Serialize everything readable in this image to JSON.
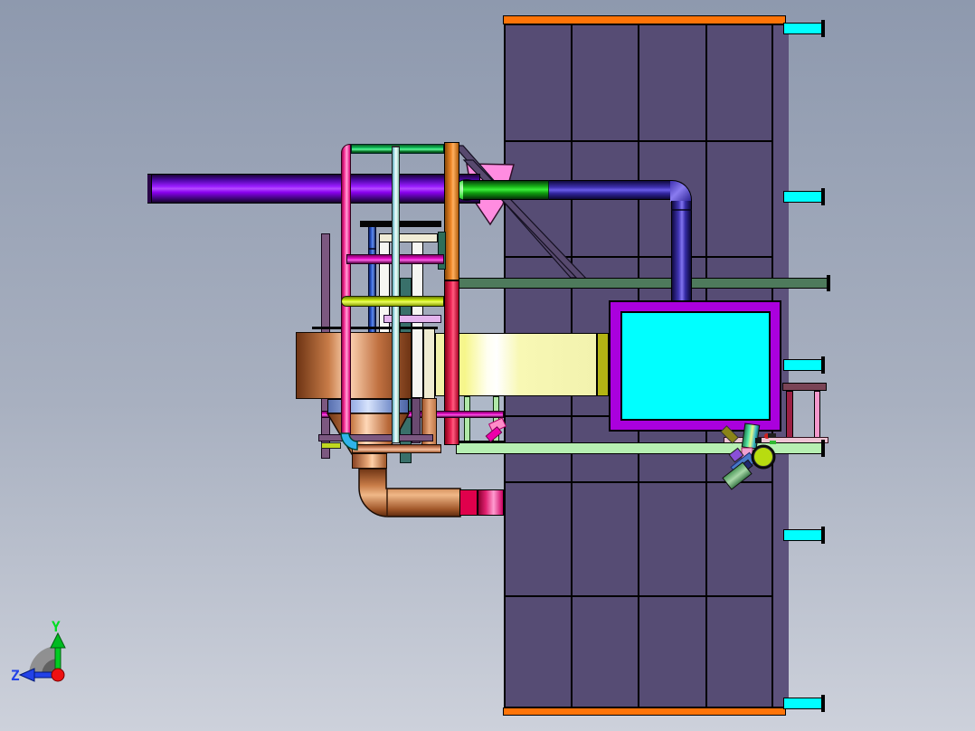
{
  "viewport": {
    "kind": "cad-3d-view"
  },
  "triad": {
    "y_label": "Y",
    "z_label": "Z",
    "y_color": "#00cc22",
    "z_color": "#2342e8",
    "origin_color": "#ee1111"
  },
  "colors": {
    "bg-top": "#8e99ae",
    "bg-bottom": "#cdd1db",
    "panel": "#564c74",
    "panel-edge": "#5d527c",
    "orange": "#ff7408",
    "cyan": "#00ffff",
    "beam-green": "#4e7a5c",
    "beam-pale": "#b6efb2",
    "pipe-purple": "#8b00f0",
    "pipe-green": "#18d018",
    "pipe-indigo": "#4a38c8",
    "tank-frame": "#aa00dd",
    "tank-screen": "#00ffff",
    "duct-yellow": "#f6f6b2",
    "duct-olive": "#b4b414",
    "column-orange": "#e87c18",
    "column-red": "#e8003c",
    "copper": "#cd8050",
    "band-blue": "#9cb0e0",
    "crimson": "#e0004c",
    "pink-segment": "#ff7ec2",
    "pipe-pink": "#ff4aa8",
    "pipe-magenta": "#ee00cc",
    "pipe-chartreuse": "#d4f000",
    "pipe-lavender": "#e4b4ee",
    "pipe-cyan-light": "#cceef4",
    "pipe-blue": "#3a6ae0",
    "post-mauve": "#7c5880",
    "teal": "#39706a",
    "plate-teal": "#2e6e5a",
    "cream": "#f0ecd6",
    "white-part": "#f6f6f2",
    "salmon": "#dd9070",
    "gusset-pink": "#ff8ce0",
    "brace": "#57496e",
    "backdrop": "#aeb8c8",
    "post-green": "#b0e8a8",
    "table-top": "#7a4456",
    "table-post-red": "#9c2044",
    "table-post-pink": "#f598cc",
    "table-ledge": "#eec4d4",
    "pump-wheel": "#b8dc10",
    "pump-blue": "#4878c8",
    "pump-green": "#88c888",
    "pump-olive": "#8a8418"
  }
}
